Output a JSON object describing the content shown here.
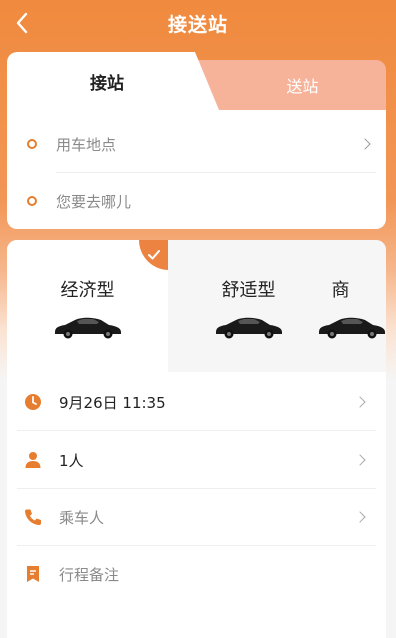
{
  "header": {
    "title": "接送站"
  },
  "tabs": {
    "active": "接站",
    "inactive": "送站"
  },
  "locations": {
    "pickup_placeholder": "用车地点",
    "destination_placeholder": "您要去哪儿"
  },
  "car_types": [
    {
      "name": "经济型",
      "selected": true
    },
    {
      "name": "舒适型",
      "selected": false
    },
    {
      "name": "商",
      "selected": false
    }
  ],
  "form": {
    "time": "9月26日 11:35",
    "passengers": "1人",
    "rider_placeholder": "乘车人",
    "notes_placeholder": "行程备注"
  },
  "colors": {
    "accent": "#ec8340",
    "tab_inactive": "#f6b39a"
  }
}
